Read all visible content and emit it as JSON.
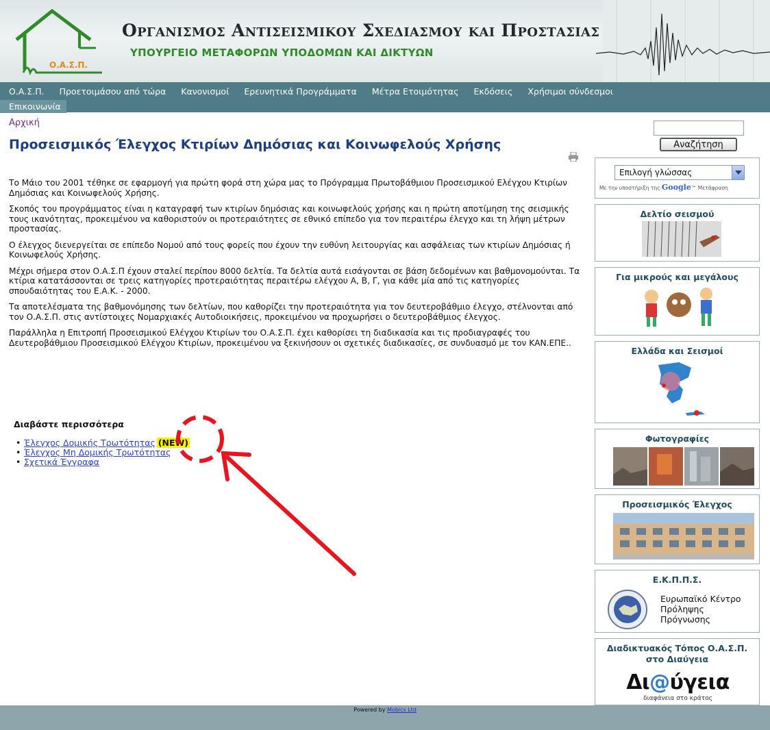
{
  "header": {
    "title": "Οργανισμος Αντισεισμικου Σχεδιασμου και Προστασιας",
    "subtitle": "ΥΠΟΥΡΓΕΙΟ ΜΕΤΑΦΟΡΩΝ ΥΠΟΔΟΜΩΝ ΚΑΙ ΔΙΚΤΥΩΝ",
    "logo_text": "Ο.Α.Σ.Π."
  },
  "nav": {
    "row1": [
      "Ο.Α.Σ.Π.",
      "Προετοιμάσου από τώρα",
      "Κανονισμοί",
      "Ερευνητικά Προγράμματα",
      "Μέτρα Ετοιμότητας",
      "Εκδόσεις",
      "Χρήσιμοι σύνδεσμοι"
    ],
    "row2": [
      "Επικοινωνία"
    ]
  },
  "breadcrumb": "Αρχική",
  "page_title": "Προσεισμικός Έλεγχος Κτιρίων Δημόσιας και Κοινωφελούς Χρήσης",
  "paragraphs": [
    "Το Μάιο του 2001 τέθηκε σε εφαρμογή για πρώτη φορά στη χώρα μας το Πρόγραμμα Πρωτοβάθμιου Προσεισμικού Ελέγχου Κτιρίων Δημόσιας και Κοινωφελούς Χρήσης.",
    "Σκοπός του προγράμματος είναι η καταγραφή των κτιρίων δημόσιας και κοινωφελούς χρήσης και η πρώτη αποτίμηση της σεισμικής τους ικανότητας, προκειμένου να καθοριστούν οι προτεραιότητες σε εθνικό επίπεδο για τον περαιτέρω έλεγχο και τη λήψη μέτρων προστασίας.",
    "Ο έλεγχος διενεργείται σε επίπεδο Νομού από τους φορείς που έχουν την ευθύνη λειτουργίας και ασφάλειας των κτιρίων Δημόσιας ή Κοινωφελούς Χρήσης.",
    "Μέχρι σήμερα στον Ο.Α.Σ.Π έχουν σταλεί περίπου 8000 δελτία. Τα δελτία αυτά εισάγονται σε βάση δεδομένων και βαθμονομούνται. Τα κτίρια κατατάσσονται σε τρεις κατηγορίες προτεραιότητας περαιτέρω ελέγχου Α, Β, Γ, για κάθε μία από τις κατηγορίες σπουδαιότητας του Ε.Α.Κ. - 2000.",
    "Τα αποτελέσματα της βαθμονόμησης των δελτίων, που καθορίζει την προτεραιότητα για τον δευτεροβάθμιο έλεγχο, στέλνονται από τον Ο.Α.Σ.Π. στις αντίστοιχες Νομαρχιακές Αυτοδιοικήσεις, προκειμένου να προχωρήσει ο δευτεροβάθμιος έλεγχος.",
    "Παράλληλα η Επιτροπή Προσεισμικού Ελέγχου Κτιρίων του Ο.Α.Σ.Π. έχει καθορίσει τη διαδικασία και τις προδιαγραφές του Δευτεροβάθμιου Προσεισμικού Ελέγχου Κτιρίων, προκειμένου να ξεκινήσουν οι σχετικές διαδικασίες, σε συνδυασμό με τον ΚΑΝ.ΕΠΕ.."
  ],
  "read_more": {
    "title": "Διαβάστε περισσότερα",
    "links": [
      "Έλεγχος Δομικής Τρωτότητας",
      "Έλεγχος Μη Δομικής Τρωτότητας",
      "Σχετικά Έγγραφα"
    ],
    "new_badge": "(NEW)"
  },
  "sidebar": {
    "search_value": "",
    "search_button": "Αναζήτηση",
    "language_select": "Επιλογή γλώσσας",
    "google_note_prefix": "Με την υποστήριξη της",
    "google_brand": "Google",
    "google_note_suffix": "™ Μετάφραση",
    "boxes": {
      "bulletin": "Δελτίο σεισμού",
      "kids": "Για μικρούς και μεγάλους",
      "greece": "Ελλάδα και Σεισμοί",
      "photos": "Φωτογραφίες",
      "precheck": "Προσεισμικός Έλεγχος",
      "ekpps": "Ε.Κ.Π.Π.Σ.",
      "ekpps_text": [
        "Ευρωπαϊκό Κέντρο",
        "Πρόληψης",
        "Πρόγνωσης"
      ],
      "diavgeia_title_1": "Διαδικτυακός Τόπος Ο.Α.Σ.Π.",
      "diavgeia_title_2": "στο Διαύγεια",
      "diavgeia_logo_a": "Δι",
      "diavgeia_logo_at": "@",
      "diavgeia_logo_b": "ύγεια",
      "diavgeia_sub": "διαφάνεια στο κράτος"
    }
  },
  "footer": {
    "prefix": "Powered by",
    "link": "Mobics Ltd"
  },
  "colors": {
    "nav_bg": "#507c88",
    "title_blue": "#1c3f82",
    "annotation_red": "#e8141e",
    "new_badge": "#f6f200"
  }
}
